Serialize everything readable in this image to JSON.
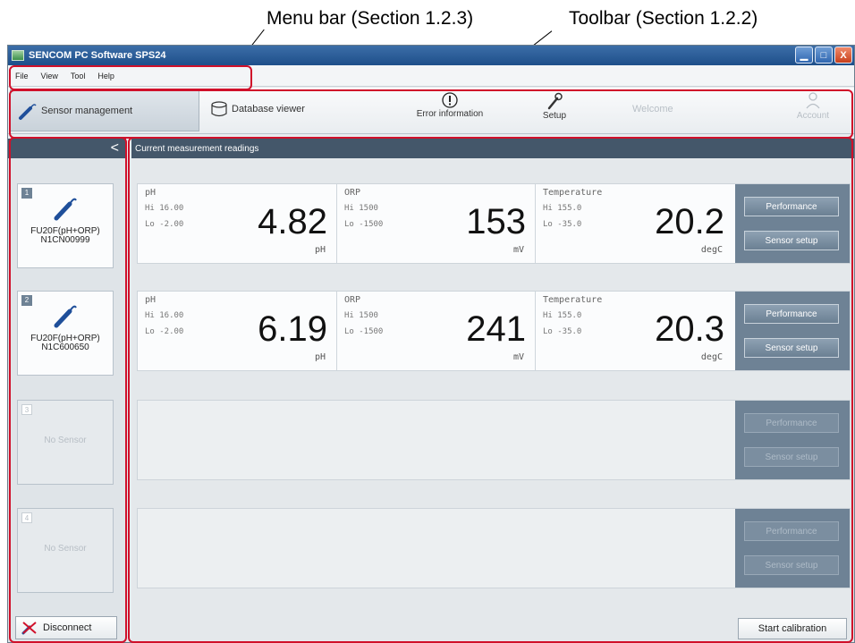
{
  "callouts": {
    "menu_bar": "Menu bar (Section 1.2.3)",
    "toolbar": "Toolbar (Section 1.2.2)"
  },
  "window": {
    "title": "SENCOM PC Software SPS24",
    "buttons": {
      "minimize": "▁",
      "maximize": "□",
      "close": "X"
    }
  },
  "menu": [
    "File",
    "View",
    "Tool",
    "Help"
  ],
  "toolbar": {
    "sensor_management": "Sensor management",
    "database_viewer": "Database viewer",
    "error_information": "Error information",
    "setup": "Setup",
    "welcome": "Welcome",
    "account": "Account"
  },
  "sidebar": {
    "collapse": "<",
    "cards": [
      {
        "num": "1",
        "line1": "FU20F(pH+ORP)",
        "line2": "N1CN00999"
      },
      {
        "num": "2",
        "line1": "FU20F(pH+ORP)",
        "line2": "N1C600650"
      },
      {
        "num": "3",
        "line1": "No Sensor",
        "line2": ""
      },
      {
        "num": "4",
        "line1": "No Sensor",
        "line2": ""
      }
    ],
    "disconnect": "Disconnect"
  },
  "main": {
    "header": "Current measurement readings",
    "rows": [
      {
        "ph": {
          "label": "pH",
          "hi": "Hi 16.00",
          "lo": "Lo -2.00",
          "value": "4.82",
          "unit": "pH"
        },
        "orp": {
          "label": "ORP",
          "hi": "Hi  1500",
          "lo": "Lo -1500",
          "value": "153",
          "unit": "mV"
        },
        "temp": {
          "label": "Temperature",
          "hi": "Hi 155.0",
          "lo": "Lo -35.0",
          "value": "20.2",
          "unit": "degC"
        }
      },
      {
        "ph": {
          "label": "pH",
          "hi": "Hi 16.00",
          "lo": "Lo -2.00",
          "value": "6.19",
          "unit": "pH"
        },
        "orp": {
          "label": "ORP",
          "hi": "Hi  1500",
          "lo": "Lo -1500",
          "value": "241",
          "unit": "mV"
        },
        "temp": {
          "label": "Temperature",
          "hi": "Hi 155.0",
          "lo": "Lo -35.0",
          "value": "20.3",
          "unit": "degC"
        }
      }
    ],
    "performance": "Performance",
    "sensor_setup": "Sensor setup",
    "start_calibration": "Start calibration"
  },
  "colors": {
    "highlight": "#d0102a",
    "header": "#44576a",
    "button_panel": "#6e8295"
  }
}
